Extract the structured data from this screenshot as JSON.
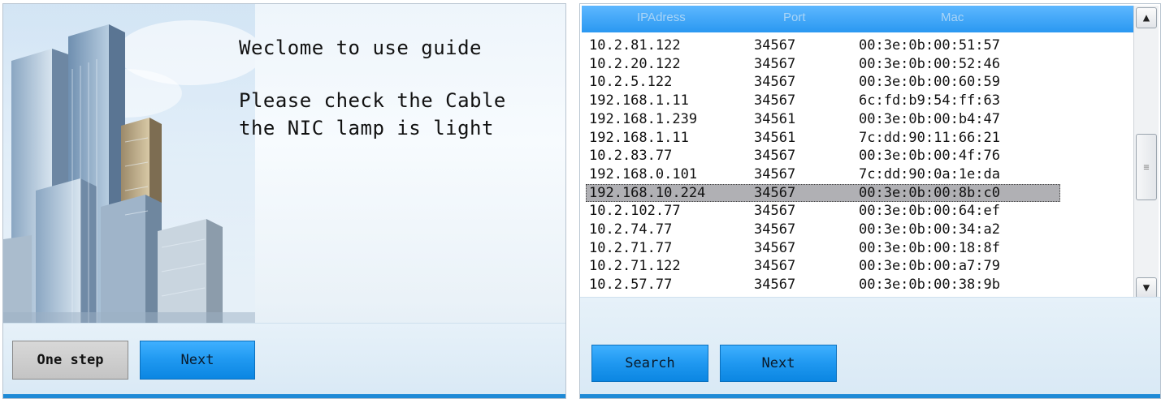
{
  "left_panel": {
    "welcome_line1": "Weclome to use guide",
    "check_line1": "Please check the Cable",
    "check_line2": "the NIC lamp is light",
    "one_step_label": "One step",
    "next_label": "Next"
  },
  "right_panel": {
    "columns": [
      "IPAdress",
      "Port",
      "Mac"
    ],
    "rows": [
      {
        "ip": "10.2.81.122",
        "port": "34567",
        "mac": "00:3e:0b:00:51:57"
      },
      {
        "ip": "10.2.20.122",
        "port": "34567",
        "mac": "00:3e:0b:00:52:46"
      },
      {
        "ip": "10.2.5.122",
        "port": "34567",
        "mac": "00:3e:0b:00:60:59"
      },
      {
        "ip": "192.168.1.11",
        "port": "34567",
        "mac": "6c:fd:b9:54:ff:63"
      },
      {
        "ip": "192.168.1.239",
        "port": "34561",
        "mac": "00:3e:0b:00:b4:47"
      },
      {
        "ip": "192.168.1.11",
        "port": "34561",
        "mac": "7c:dd:90:11:66:21"
      },
      {
        "ip": "10.2.83.77",
        "port": "34567",
        "mac": "00:3e:0b:00:4f:76"
      },
      {
        "ip": "192.168.0.101",
        "port": "34567",
        "mac": "7c:dd:90:0a:1e:da"
      },
      {
        "ip": "192.168.10.224",
        "port": "34567",
        "mac": "00:3e:0b:00:8b:c0"
      },
      {
        "ip": "10.2.102.77",
        "port": "34567",
        "mac": "00:3e:0b:00:64:ef"
      },
      {
        "ip": "10.2.74.77",
        "port": "34567",
        "mac": "00:3e:0b:00:34:a2"
      },
      {
        "ip": "10.2.71.77",
        "port": "34567",
        "mac": "00:3e:0b:00:18:8f"
      },
      {
        "ip": "10.2.71.122",
        "port": "34567",
        "mac": "00:3e:0b:00:a7:79"
      },
      {
        "ip": "10.2.57.77",
        "port": "34567",
        "mac": "00:3e:0b:00:38:9b"
      }
    ],
    "selected_index": 8,
    "search_label": "Search",
    "next_label": "Next"
  },
  "icons": {
    "scroll_up": "chevron-up-icon",
    "scroll_down": "chevron-down-icon",
    "scroll_grip": "grip-lines-icon",
    "city": "city-buildings-illustration"
  },
  "colors": {
    "accent_blue": "#1f98f0",
    "selection_gray": "#b0b0b4"
  }
}
